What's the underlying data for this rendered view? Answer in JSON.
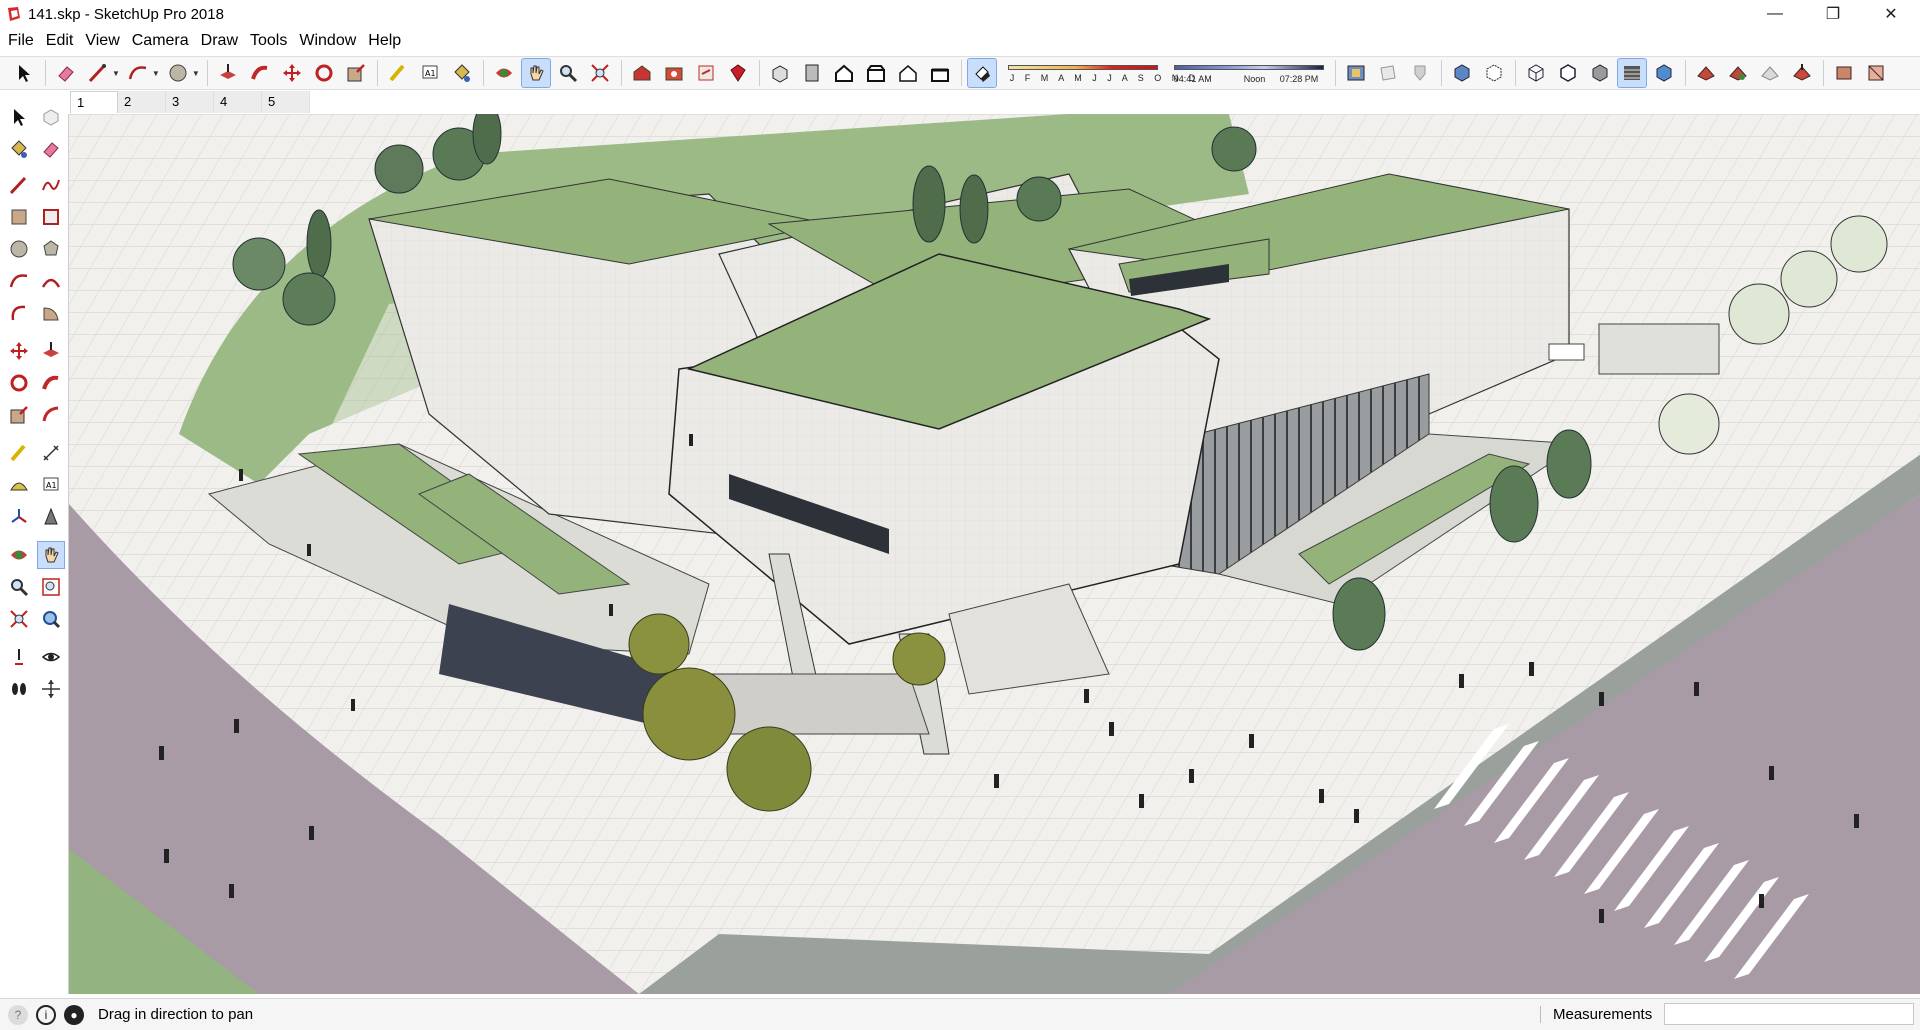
{
  "window": {
    "title": "141.skp - SketchUp Pro 2018",
    "controls": {
      "minimize": "—",
      "restore": "❐",
      "close": "✕"
    }
  },
  "menu": [
    "File",
    "Edit",
    "View",
    "Camera",
    "Draw",
    "Tools",
    "Window",
    "Help"
  ],
  "toolbar": {
    "tools": [
      {
        "name": "select-icon"
      },
      {
        "name": "eraser-icon"
      },
      {
        "name": "line-icon"
      },
      {
        "name": "arc-icon"
      },
      {
        "name": "circle-icon"
      },
      {
        "name": "push-pull-icon"
      },
      {
        "name": "follow-me-icon"
      },
      {
        "name": "move-icon"
      },
      {
        "name": "rotate-icon"
      },
      {
        "name": "scale-icon"
      },
      {
        "name": "tape-measure-icon"
      },
      {
        "name": "text-icon"
      },
      {
        "name": "paint-bucket-icon"
      },
      {
        "name": "orbit-icon"
      },
      {
        "name": "pan-icon",
        "active": true
      },
      {
        "name": "zoom-icon"
      },
      {
        "name": "zoom-extents-icon"
      },
      {
        "name": "warehouse-icon"
      },
      {
        "name": "extension-warehouse-icon"
      },
      {
        "name": "layout-icon"
      },
      {
        "name": "ruby-icon"
      },
      {
        "name": "iso-view-icon"
      },
      {
        "name": "top-view-icon"
      },
      {
        "name": "front-view-icon"
      },
      {
        "name": "right-view-icon"
      },
      {
        "name": "back-view-icon"
      },
      {
        "name": "left-view-icon"
      },
      {
        "name": "shadows-toggle-icon",
        "active": true
      }
    ],
    "shadow": {
      "months": "J F M A M J J A S O N D",
      "time_start": "04:41 AM",
      "time_mid": "Noon",
      "time_end": "07:28 PM"
    },
    "right_tools": [
      {
        "name": "section-plane-icon"
      },
      {
        "name": "display-section-icon"
      },
      {
        "name": "section-cuts-icon"
      },
      {
        "name": "xray-icon"
      },
      {
        "name": "back-edges-icon"
      },
      {
        "name": "wireframe-icon"
      },
      {
        "name": "hidden-line-icon"
      },
      {
        "name": "shaded-icon"
      },
      {
        "name": "shaded-textures-icon",
        "active": true
      },
      {
        "name": "monochrome-icon"
      },
      {
        "name": "sandbox-1-icon"
      },
      {
        "name": "sandbox-2-icon"
      },
      {
        "name": "sandbox-3-icon"
      },
      {
        "name": "sandbox-4-icon"
      },
      {
        "name": "extension-1-icon"
      },
      {
        "name": "extension-2-icon"
      }
    ]
  },
  "scenes": [
    "1",
    "2",
    "3",
    "4",
    "5"
  ],
  "status": {
    "hint": "Drag in direction to pan",
    "measurements_label": "Measurements",
    "measurements_value": ""
  },
  "colors": {
    "roof_green": "#93b37a",
    "facade": "#e9e9e6",
    "road": "#a89aa6",
    "paving": "#f2f1ee",
    "lawn": "#8fb57d",
    "shadow_panel": "#3c4250"
  }
}
